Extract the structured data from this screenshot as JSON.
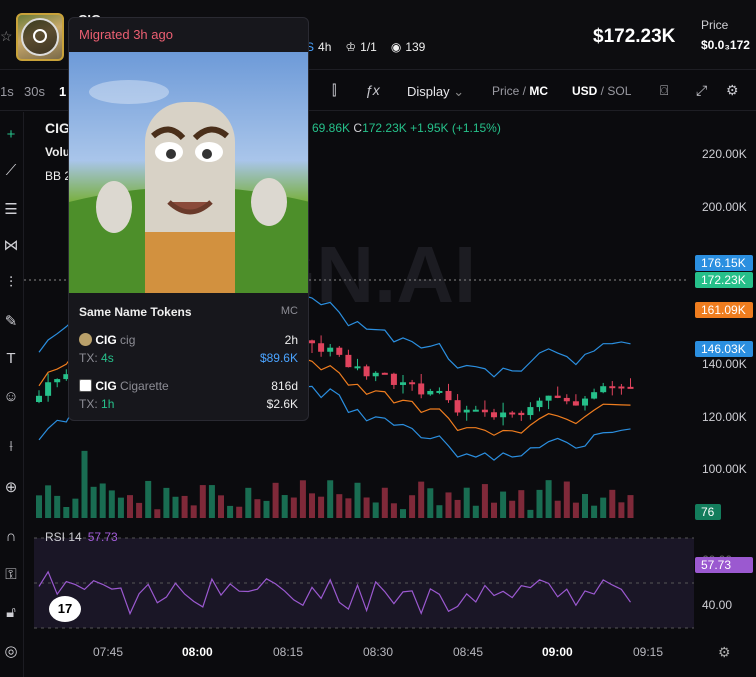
{
  "header": {
    "token_name": "CIG",
    "stats": {
      "timeframe": "4h",
      "holders": "1/1",
      "views": "139"
    },
    "market_cap": "$172.23K",
    "price_label": "Price",
    "price_value": "$0.0₃172"
  },
  "toolbar": {
    "timeframes": [
      "1s",
      "30s",
      "1"
    ],
    "display_label": "Display",
    "price_mc": {
      "a": "Price",
      "sep": " / ",
      "b": "MC"
    },
    "currency": {
      "a": "USD",
      "sep": " / ",
      "b": "SOL"
    }
  },
  "chart_legend": {
    "symbol": "CIG",
    "volume": "Volu",
    "bb": "BB 2",
    "ohlc_tail": "69.86K",
    "close_label": "C",
    "close": "172.23K",
    "change": "+1.95K (+1.15%)"
  },
  "popup": {
    "title": "Migrated 3h ago",
    "section": "Same Name Tokens",
    "mc_header": "MC",
    "tokens": [
      {
        "name": "CIG",
        "sub": "cig",
        "age": "2h",
        "tx_label": "TX:",
        "tx": "4s",
        "mc": "$89.6K"
      },
      {
        "name": "CIG",
        "sub": "Cigarette",
        "age": "816d",
        "tx_label": "TX:",
        "tx": "1h",
        "mc": "$2.6K"
      }
    ]
  },
  "y_axis": [
    "220.00K",
    "200.00K",
    "140.00K",
    "120.00K",
    "100.00K"
  ],
  "price_tags": {
    "upper": "176.15K",
    "last": "172.23K",
    "mid": "161.09K",
    "lower": "146.03K",
    "volume": "76"
  },
  "rsi": {
    "label": "RSI 14",
    "value": "57.73",
    "tag": "57.73",
    "tag_under": "60.00",
    "level": "40.00"
  },
  "x_axis": [
    "07:45",
    "08:00",
    "08:15",
    "08:30",
    "08:45",
    "09:00",
    "09:15"
  ],
  "watermark": "GN.AI",
  "tv_logo": "17",
  "colors": {
    "up": "#26c08a",
    "down": "#e0435d",
    "bb": "#2b8fe0",
    "ma": "#ef7d1f",
    "rsi": "#9b59d0"
  }
}
